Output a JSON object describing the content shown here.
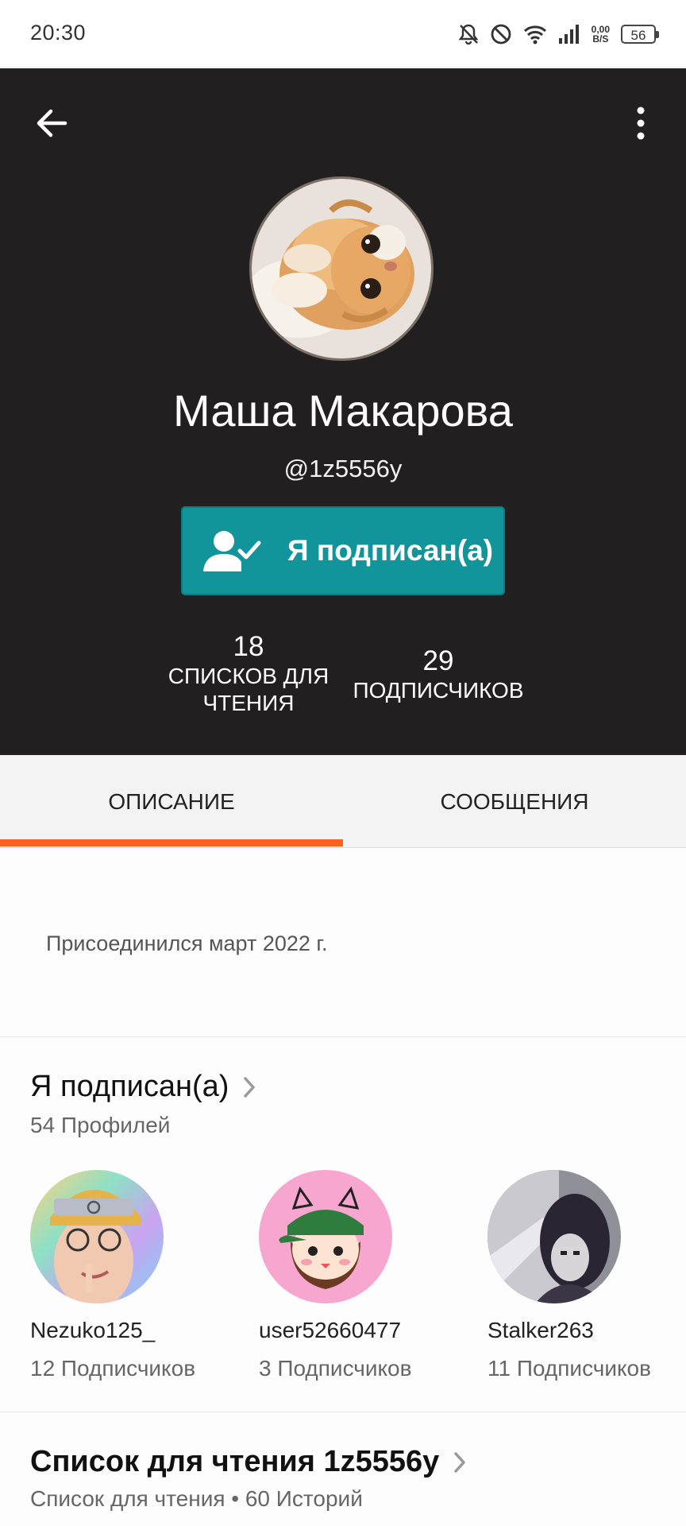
{
  "status_bar": {
    "time": "20:30",
    "net_speed_value": "0,00",
    "net_speed_unit": "B/S",
    "battery": "56"
  },
  "profile": {
    "name": "Маша Макарова",
    "handle": "@1z5556y",
    "follow_button": "Я подписан(а)",
    "stats": {
      "reading_lists_count": "18",
      "reading_lists_label_line1": "СПИСКОВ ДЛЯ",
      "reading_lists_label_line2": "ЧТЕНИЯ",
      "followers_count": "29",
      "followers_label": "ПОДПИСЧИКОВ"
    }
  },
  "tabs": [
    {
      "label": "ОПИСАНИЕ",
      "active": true
    },
    {
      "label": "СООБЩЕНИЯ",
      "active": false
    }
  ],
  "about": {
    "joined": "Присоединился март 2022 г."
  },
  "following": {
    "title": "Я подписан(а)",
    "subtitle": "54 Профилей",
    "profiles": [
      {
        "username": "Nezuko125_",
        "followers": "12 Подписчиков"
      },
      {
        "username": "user52660477",
        "followers": "3 Подписчиков"
      },
      {
        "username": "Stalker263",
        "followers": "11 Подписчиков"
      }
    ]
  },
  "reading_list": {
    "title": "Список для чтения 1z5556y",
    "subtitle": "Список для чтения • 60 Историй"
  },
  "colors": {
    "header_bg": "#221f20",
    "follow_button": "#11959b",
    "tab_indicator": "#ff5f1f"
  },
  "icons": [
    "back-arrow-icon",
    "more-vert-icon",
    "bell-off-icon",
    "dnd-icon",
    "wifi-icon",
    "signal-icon",
    "follow-check-icon",
    "chevron-right-icon"
  ]
}
